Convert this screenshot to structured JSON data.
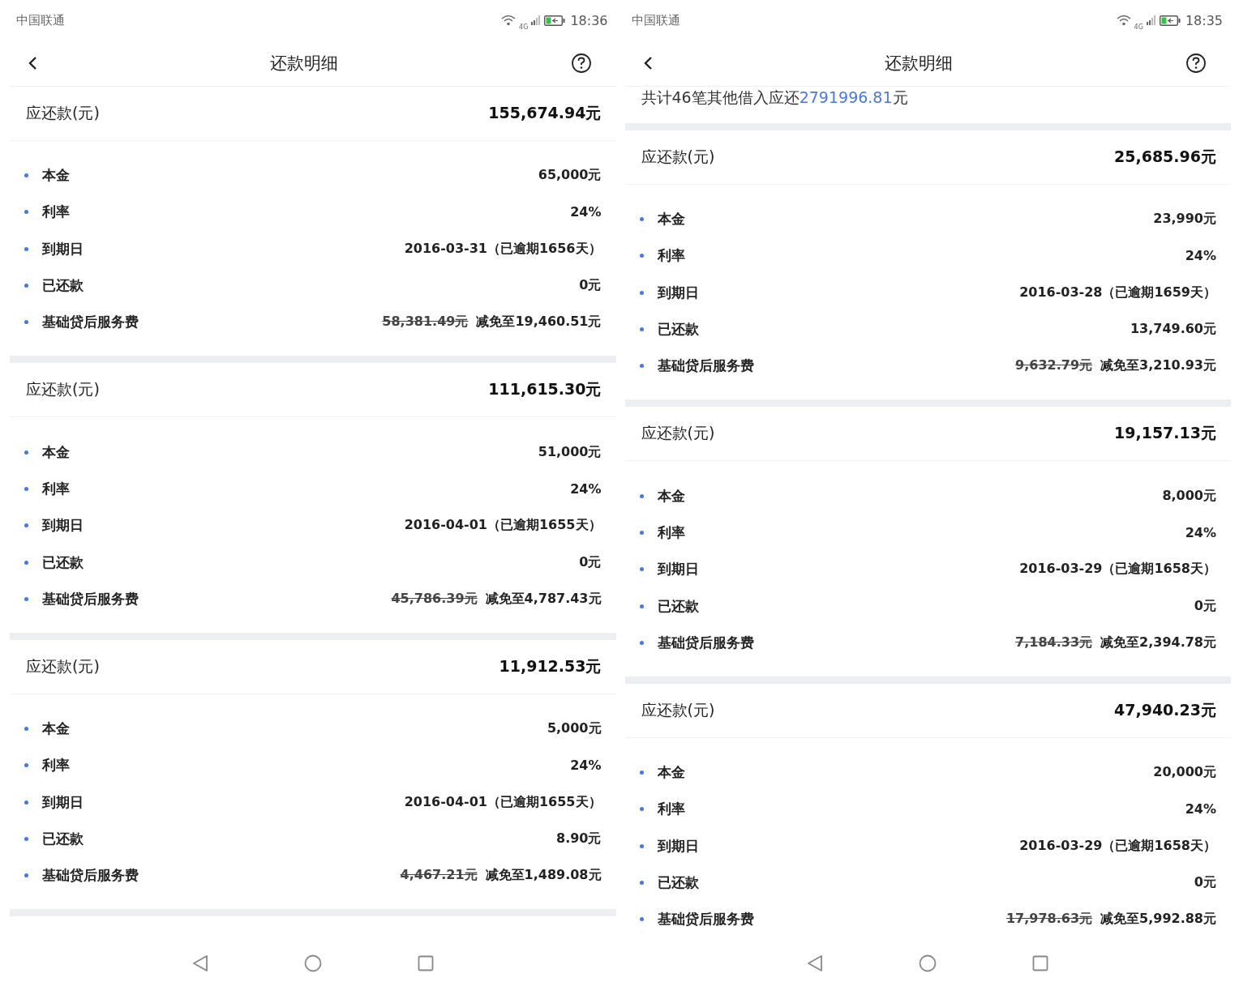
{
  "phones": [
    {
      "status_bar": {
        "carrier": "中国联通",
        "network": "4G",
        "time": "18:36"
      },
      "title": "还款明细",
      "end_divider": true,
      "loans": [
        {
          "label": "应还款(元)",
          "amount": "155,674.94元",
          "details": [
            {
              "kind": "plain",
              "label": "本金",
              "value": "65,000元"
            },
            {
              "kind": "plain",
              "label": "利率",
              "value": "24%"
            },
            {
              "kind": "plain",
              "label": "到期日",
              "value": "2016-03-31（已逾期1656天）"
            },
            {
              "kind": "plain",
              "label": "已还款",
              "value": "0元"
            },
            {
              "kind": "fee",
              "label": "基础贷后服务费",
              "original": "58,381.49元",
              "value": "减免至19,460.51元"
            }
          ]
        },
        {
          "label": "应还款(元)",
          "amount": "111,615.30元",
          "details": [
            {
              "kind": "plain",
              "label": "本金",
              "value": "51,000元"
            },
            {
              "kind": "plain",
              "label": "利率",
              "value": "24%"
            },
            {
              "kind": "plain",
              "label": "到期日",
              "value": "2016-04-01（已逾期1655天）"
            },
            {
              "kind": "plain",
              "label": "已还款",
              "value": "0元"
            },
            {
              "kind": "fee",
              "label": "基础贷后服务费",
              "original": "45,786.39元",
              "value": "减免至4,787.43元"
            }
          ]
        },
        {
          "label": "应还款(元)",
          "amount": "11,912.53元",
          "details": [
            {
              "kind": "plain",
              "label": "本金",
              "value": "5,000元"
            },
            {
              "kind": "plain",
              "label": "利率",
              "value": "24%"
            },
            {
              "kind": "plain",
              "label": "到期日",
              "value": "2016-04-01（已逾期1655天）"
            },
            {
              "kind": "plain",
              "label": "已还款",
              "value": "8.90元"
            },
            {
              "kind": "fee",
              "label": "基础贷后服务费",
              "original": "4,467.21元",
              "value": "减免至1,489.08元"
            }
          ]
        }
      ]
    },
    {
      "status_bar": {
        "carrier": "中国联通",
        "network": "4G",
        "time": "18:35"
      },
      "title": "还款明细",
      "end_divider": false,
      "summary": {
        "prefix": "共计46笔其他借入应还",
        "highlight": "2791996.81",
        "suffix": "元"
      },
      "loans": [
        {
          "label": "应还款(元)",
          "amount": "25,685.96元",
          "details": [
            {
              "kind": "plain",
              "label": "本金",
              "value": "23,990元"
            },
            {
              "kind": "plain",
              "label": "利率",
              "value": "24%"
            },
            {
              "kind": "plain",
              "label": "到期日",
              "value": "2016-03-28（已逾期1659天）"
            },
            {
              "kind": "plain",
              "label": "已还款",
              "value": "13,749.60元"
            },
            {
              "kind": "fee",
              "label": "基础贷后服务费",
              "original": "9,632.79元",
              "value": "减免至3,210.93元"
            }
          ]
        },
        {
          "label": "应还款(元)",
          "amount": "19,157.13元",
          "details": [
            {
              "kind": "plain",
              "label": "本金",
              "value": "8,000元"
            },
            {
              "kind": "plain",
              "label": "利率",
              "value": "24%"
            },
            {
              "kind": "plain",
              "label": "到期日",
              "value": "2016-03-29（已逾期1658天）"
            },
            {
              "kind": "plain",
              "label": "已还款",
              "value": "0元"
            },
            {
              "kind": "fee",
              "label": "基础贷后服务费",
              "original": "7,184.33元",
              "value": "减免至2,394.78元"
            }
          ]
        },
        {
          "label": "应还款(元)",
          "amount": "47,940.23元",
          "details": [
            {
              "kind": "plain",
              "label": "本金",
              "value": "20,000元"
            },
            {
              "kind": "plain",
              "label": "利率",
              "value": "24%"
            },
            {
              "kind": "plain",
              "label": "到期日",
              "value": "2016-03-29（已逾期1658天）"
            },
            {
              "kind": "plain",
              "label": "已还款",
              "value": "0元"
            },
            {
              "kind": "fee",
              "label": "基础贷后服务费",
              "original": "17,978.63元",
              "value": "减免至5,992.88元"
            }
          ]
        }
      ]
    }
  ]
}
